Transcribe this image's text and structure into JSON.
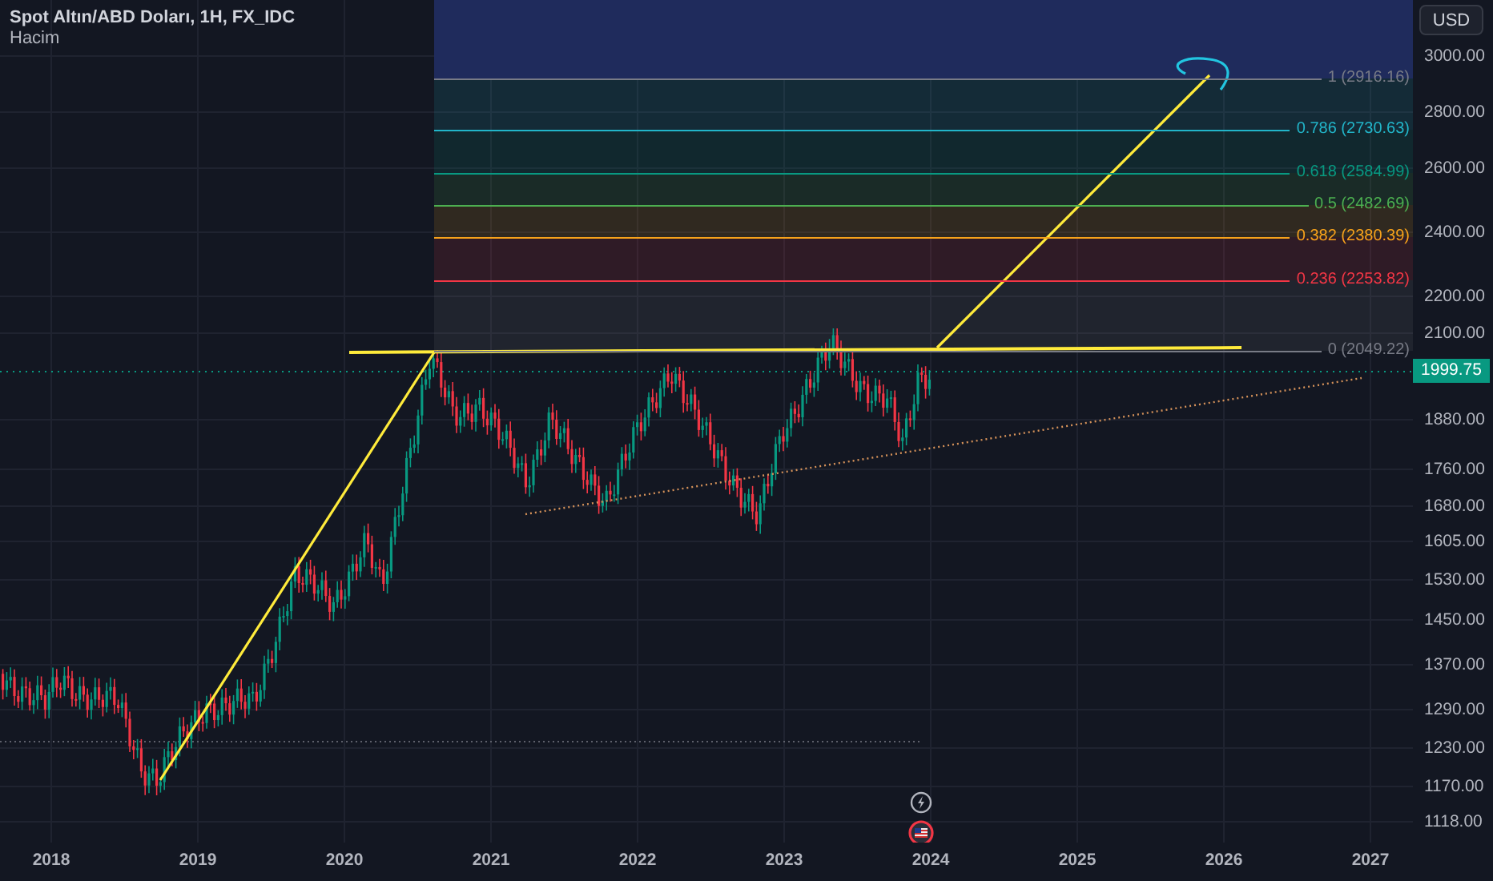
{
  "header": {
    "title": "Spot Altın/ABD Doları, 1H, FX_IDC",
    "indicator": "Hacim"
  },
  "currency_button": "USD",
  "price_axis": {
    "ticks": [
      "3000.00",
      "2800.00",
      "2600.00",
      "2400.00",
      "2200.00",
      "2100.00",
      "1880.00",
      "1760.00",
      "1680.00",
      "1605.00",
      "1530.00",
      "1450.00",
      "1370.00",
      "1290.00",
      "1230.00",
      "1170.00",
      "1118.00"
    ]
  },
  "current_price": {
    "label": "1999.75"
  },
  "time_axis": {
    "labels": [
      "2018",
      "2019",
      "2020",
      "2021",
      "2022",
      "2023",
      "2024",
      "2025",
      "2026",
      "2027"
    ]
  },
  "fibonacci": {
    "levels": [
      {
        "label": "1 (2916.16)",
        "color": "#787b86"
      },
      {
        "label": "0.786 (2730.63)",
        "color": "#22b5c9"
      },
      {
        "label": "0.618 (2584.99)",
        "color": "#089981"
      },
      {
        "label": "0.5 (2482.69)",
        "color": "#4caf50"
      },
      {
        "label": "0.382 (2380.39)",
        "color": "#f7a21b"
      },
      {
        "label": "0.236 (2253.82)",
        "color": "#f23645"
      },
      {
        "label": "0 (2049.22)",
        "color": "#787b86"
      }
    ]
  }
}
